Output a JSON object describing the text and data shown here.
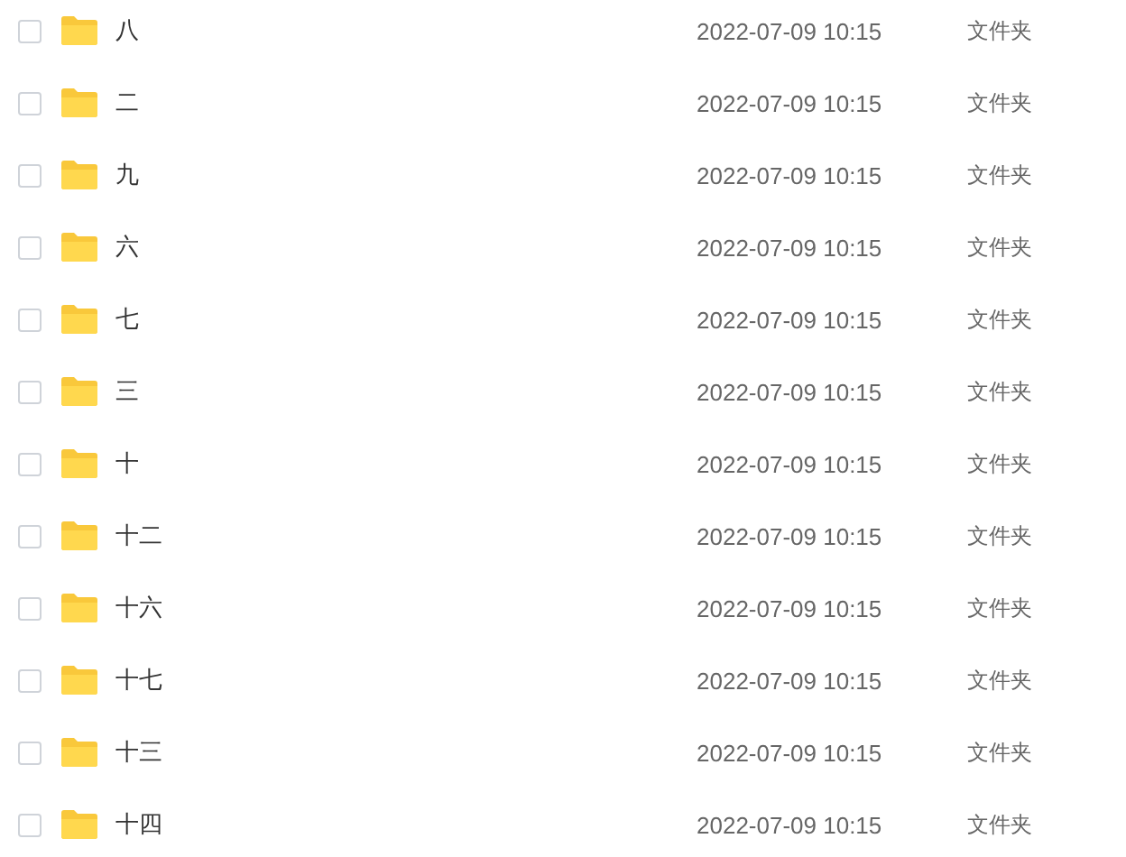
{
  "files": [
    {
      "name": "八",
      "date": "2022-07-09 10:15",
      "type": "文件夹",
      "checked": false
    },
    {
      "name": "二",
      "date": "2022-07-09 10:15",
      "type": "文件夹",
      "checked": false
    },
    {
      "name": "九",
      "date": "2022-07-09 10:15",
      "type": "文件夹",
      "checked": false
    },
    {
      "name": "六",
      "date": "2022-07-09 10:15",
      "type": "文件夹",
      "checked": false
    },
    {
      "name": "七",
      "date": "2022-07-09 10:15",
      "type": "文件夹",
      "checked": false
    },
    {
      "name": "三",
      "date": "2022-07-09 10:15",
      "type": "文件夹",
      "checked": false
    },
    {
      "name": "十",
      "date": "2022-07-09 10:15",
      "type": "文件夹",
      "checked": false
    },
    {
      "name": "十二",
      "date": "2022-07-09 10:15",
      "type": "文件夹",
      "checked": false
    },
    {
      "name": "十六",
      "date": "2022-07-09 10:15",
      "type": "文件夹",
      "checked": false
    },
    {
      "name": "十七",
      "date": "2022-07-09 10:15",
      "type": "文件夹",
      "checked": false
    },
    {
      "name": "十三",
      "date": "2022-07-09 10:15",
      "type": "文件夹",
      "checked": false
    },
    {
      "name": "十四",
      "date": "2022-07-09 10:15",
      "type": "文件夹",
      "checked": false
    }
  ]
}
